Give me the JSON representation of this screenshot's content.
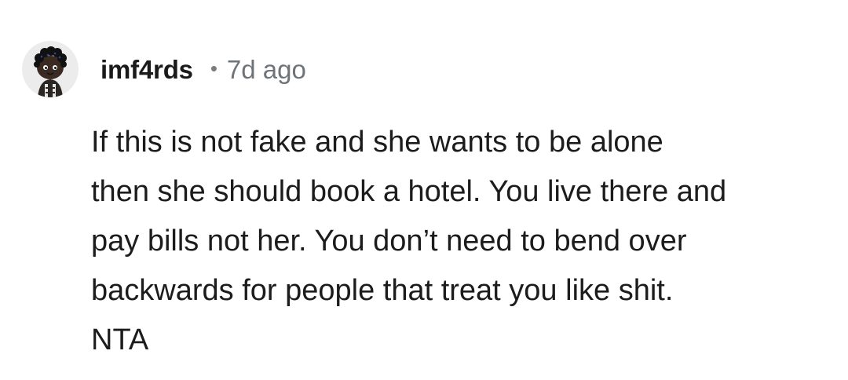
{
  "comment": {
    "username": "imf4rds",
    "separator": "•",
    "timestamp": "7d ago",
    "body_lines": [
      "If this is not fake and she wants to be alone",
      "then she should book a hotel. You live there and",
      "pay bills not her. You don’t need to bend over",
      "backwards for people that treat you like shit.",
      "NTA"
    ]
  },
  "colors": {
    "username": "#1a1a1b",
    "timestamp": "#6e7378",
    "body_text": "#1c1c1c",
    "avatar_background": "#ececec"
  },
  "icons": {
    "avatar": "snoo-avatar-icon"
  }
}
